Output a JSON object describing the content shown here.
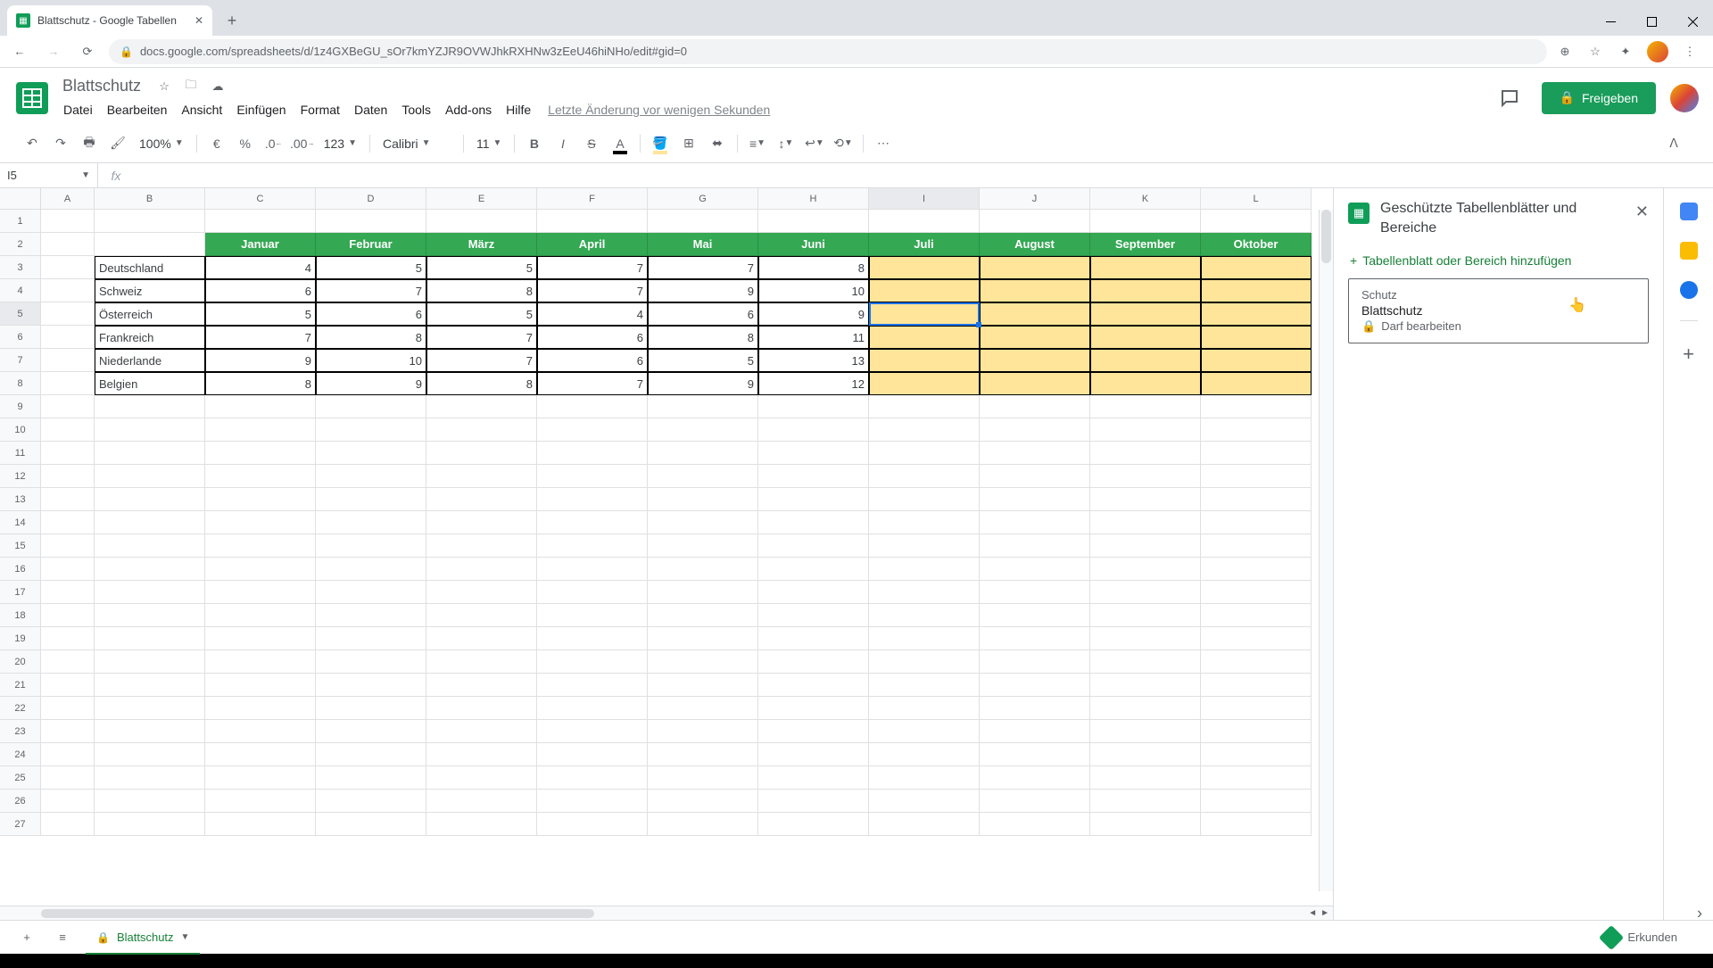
{
  "browser": {
    "tab_title": "Blattschutz - Google Tabellen",
    "url": "docs.google.com/spreadsheets/d/1z4GXBeGU_sOr7kmYZJR9OVWJhkRXHNw3zEeU46hiNHo/edit#gid=0"
  },
  "doc": {
    "title": "Blattschutz",
    "last_edit": "Letzte Änderung vor wenigen Sekunden",
    "share": "Freigeben"
  },
  "menus": [
    "Datei",
    "Bearbeiten",
    "Ansicht",
    "Einfügen",
    "Format",
    "Daten",
    "Tools",
    "Add-ons",
    "Hilfe"
  ],
  "toolbar": {
    "zoom": "100%",
    "currency": "€",
    "percent": "%",
    "dec_dec": ".0",
    "inc_dec": ".00",
    "num_format": "123",
    "font": "Calibri",
    "size": "11"
  },
  "name_box": "I5",
  "columns": [
    "A",
    "B",
    "C",
    "D",
    "E",
    "F",
    "G",
    "H",
    "I",
    "J",
    "K",
    "L"
  ],
  "selected_col": "I",
  "selected_row": 5,
  "months": [
    "Januar",
    "Februar",
    "März",
    "April",
    "Mai",
    "Juni",
    "Juli",
    "August",
    "September",
    "Oktober"
  ],
  "countries": [
    "Deutschland",
    "Schweiz",
    "Österreich",
    "Frankreich",
    "Niederlande",
    "Belgien"
  ],
  "data": [
    [
      4,
      5,
      5,
      7,
      7,
      8
    ],
    [
      6,
      7,
      8,
      7,
      9,
      10
    ],
    [
      5,
      6,
      5,
      4,
      6,
      9
    ],
    [
      7,
      8,
      7,
      6,
      8,
      11
    ],
    [
      9,
      10,
      7,
      6,
      5,
      13
    ],
    [
      8,
      9,
      8,
      7,
      9,
      12
    ]
  ],
  "side_panel": {
    "title": "Geschützte Tabellenblätter und Bereiche",
    "add": "Tabellenblatt oder Bereich hinzufügen",
    "item": {
      "type": "Schutz",
      "name": "Blattschutz",
      "perm": "Darf bearbeiten"
    }
  },
  "sheet_tab": "Blattschutz",
  "explore": "Erkunden"
}
